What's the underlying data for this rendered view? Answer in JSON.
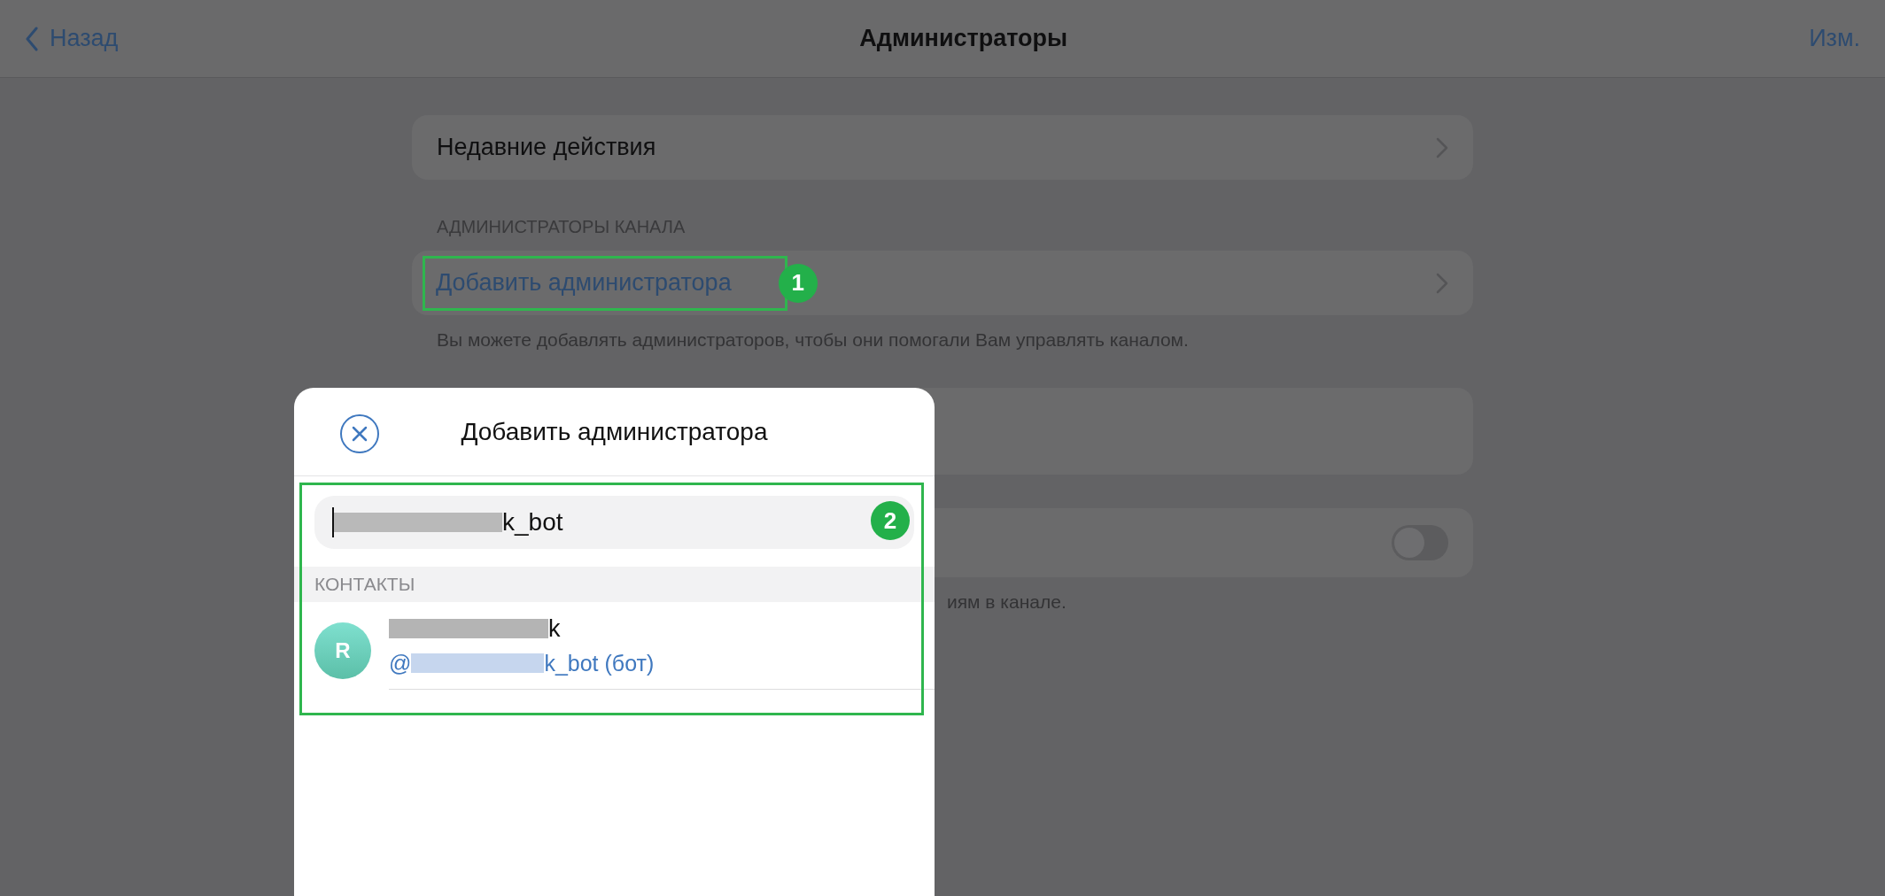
{
  "nav": {
    "back": "Назад",
    "title": "Администраторы",
    "edit": "Изм."
  },
  "sections": [
    {
      "rows": [
        {
          "kind": "link",
          "label": "Недавние действия",
          "accent": false
        }
      ]
    },
    {
      "header": "АДМИНИСТРАТОРЫ КАНАЛА",
      "rows": [
        {
          "kind": "link",
          "label": "Добавить администратора",
          "accent": true,
          "annotation": "1"
        }
      ],
      "footer": "Вы можете добавлять администраторов, чтобы они помогали Вам управлять каналом."
    },
    {
      "rows": [
        {
          "kind": "blank"
        }
      ]
    },
    {
      "rows": [
        {
          "kind": "toggle",
          "on": false
        }
      ],
      "footer": "иям в канале."
    }
  ],
  "dialog": {
    "annotation": "2",
    "title": "Добавить администратора",
    "search": {
      "value": "k_bot"
    },
    "section": "КОНТАКТЫ",
    "contacts": [
      {
        "initial": "R",
        "name": "k",
        "handle_prefix": "@",
        "handle": "k_bot (бот)"
      }
    ]
  }
}
